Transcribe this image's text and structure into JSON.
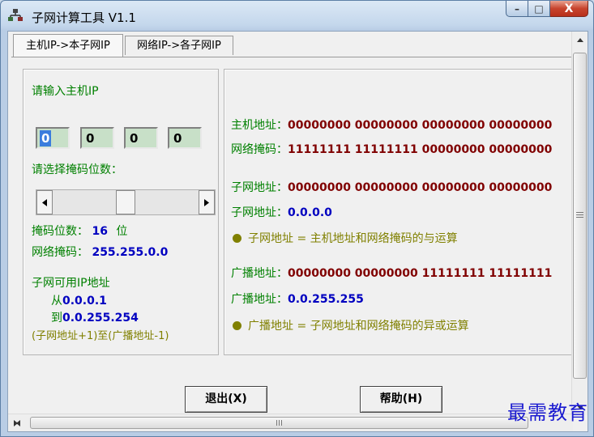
{
  "window": {
    "title": "子网计算工具  V1.1",
    "controls": {
      "minimize": "–",
      "maximize": "□",
      "close": "X"
    }
  },
  "tabs": [
    {
      "label": "主机IP->本子网IP",
      "active": true
    },
    {
      "label": "网络IP->各子网IP",
      "active": false
    }
  ],
  "left_panel": {
    "ip_prompt": "请输入主机IP",
    "ip_octets": [
      "0",
      "0",
      "0",
      "0"
    ],
    "mask_prompt": "请选择掩码位数：",
    "mask_bits_label": "掩码位数：",
    "mask_bits_value": "16",
    "mask_bits_unit": "位",
    "netmask_label": "网络掩码：",
    "netmask_value": "255.255.0.0",
    "usable_title": "子网可用IP地址",
    "from_label": "从",
    "from_value": "0.0.0.1",
    "to_label": "到",
    "to_value": "0.0.255.254",
    "range_note": "(子网地址+1)至(广播地址-1)",
    "slider_level": 0.5
  },
  "right_panel": {
    "host_label": "主机地址：",
    "host_bits": "00000000  00000000  00000000  00000000",
    "mask_label": "网络掩码：",
    "mask_bits": "11111111  11111111  00000000  00000000",
    "subnet_label": "子网地址：",
    "subnet_bits": "00000000  00000000  00000000  00000000",
    "subnet_ip_label": "子网地址：",
    "subnet_ip": "0.0.0.0",
    "subnet_note": "子网地址 = 主机地址和网络掩码的与运算",
    "bcast_label": "广播地址：",
    "bcast_bits": "00000000  00000000  11111111  11111111",
    "bcast_ip_label": "广播地址：",
    "bcast_ip": "0.0.255.255",
    "bcast_note": "广播地址 = 子网地址和网络掩码的异或运算"
  },
  "buttons": {
    "exit": "退出(X)",
    "help": "帮助(H)"
  },
  "watermark": "最需教育",
  "colors": {
    "label": "#008000",
    "bits": "#800000",
    "ip": "#0000c0",
    "note": "#808000"
  }
}
